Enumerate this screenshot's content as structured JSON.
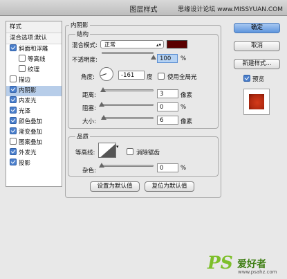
{
  "window": {
    "title": "图层样式",
    "watermark": "思缘设计论坛 www.MISSYUAN.COM"
  },
  "left_panel": {
    "header": "样式",
    "blend_options": "混合选项:默认",
    "items": [
      {
        "label": "斜面和浮雕",
        "checked": true,
        "sub": false
      },
      {
        "label": "等高线",
        "checked": false,
        "sub": true
      },
      {
        "label": "纹理",
        "checked": false,
        "sub": true
      },
      {
        "label": "描边",
        "checked": false,
        "sub": false
      },
      {
        "label": "内阴影",
        "checked": true,
        "sub": false,
        "selected": true
      },
      {
        "label": "内发光",
        "checked": true,
        "sub": false
      },
      {
        "label": "光泽",
        "checked": true,
        "sub": false
      },
      {
        "label": "颜色叠加",
        "checked": true,
        "sub": false
      },
      {
        "label": "渐变叠加",
        "checked": true,
        "sub": false
      },
      {
        "label": "图案叠加",
        "checked": false,
        "sub": false
      },
      {
        "label": "外发光",
        "checked": true,
        "sub": false
      },
      {
        "label": "投影",
        "checked": true,
        "sub": false
      }
    ]
  },
  "inner_shadow": {
    "section_title": "内阴影",
    "structure_title": "结构",
    "blend_mode_label": "混合模式:",
    "blend_mode_value": "正常",
    "shadow_color": "#5a0000",
    "opacity_label": "不透明度:",
    "opacity_value": "100",
    "opacity_unit": "%",
    "opacity_level": 1.0,
    "angle_label": "角度:",
    "angle_value": "-161",
    "angle_unit": "度",
    "global_light_label": "使用全局光",
    "global_light_checked": false,
    "distance_label": "距离:",
    "distance_value": "3",
    "distance_unit": "像素",
    "choke_label": "阻塞:",
    "choke_value": "0",
    "choke_unit": "%",
    "size_label": "大小:",
    "size_value": "6",
    "size_unit": "像素",
    "quality_title": "品质",
    "contour_label": "等高线:",
    "antialias_label": "消除锯齿",
    "antialias_checked": false,
    "noise_label": "杂色:",
    "noise_value": "0",
    "noise_unit": "%",
    "make_default": "设置为默认值",
    "reset_default": "复位为默认值"
  },
  "right": {
    "ok": "确定",
    "cancel": "取消",
    "new_style": "新建样式...",
    "preview_label": "预览",
    "preview_checked": true
  },
  "logo": {
    "ps": "PS",
    "cn": "爱好者",
    "url": "www.psahz.com"
  }
}
